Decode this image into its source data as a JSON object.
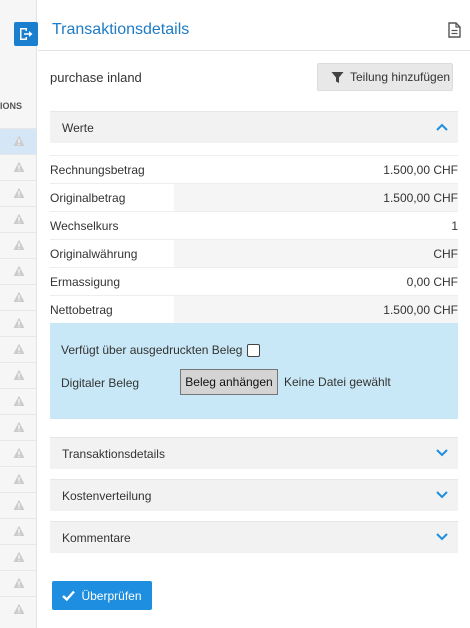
{
  "background_table": {
    "header_fragment": "IONS",
    "row_count": 19
  },
  "panel": {
    "title": "Transaktionsdetails",
    "name": "purchase inland",
    "split_button_label": "Teilung hinzufügen"
  },
  "werte": {
    "label": "Werte",
    "expanded": true,
    "rows": [
      {
        "label": "Rechnungsbetrag",
        "value": "1.500,00 CHF"
      },
      {
        "label": "Originalbetrag",
        "value": "1.500,00 CHF"
      },
      {
        "label": "Wechselkurs",
        "value": "1"
      },
      {
        "label": "Originalwährung",
        "value": "CHF"
      },
      {
        "label": "Ermassigung",
        "value": "0,00 CHF"
      },
      {
        "label": "Nettobetrag",
        "value": "1.500,00 CHF"
      }
    ]
  },
  "receipt": {
    "printed_label": "Verfügt über ausgedruckten Beleg",
    "printed_checked": false,
    "digital_label": "Digitaler Beleg",
    "attach_button_label": "Beleg anhängen",
    "no_file_text": "Keine Datei gewählt"
  },
  "sections": [
    {
      "label": "Transaktionsdetails",
      "expanded": false
    },
    {
      "label": "Kostenverteilung",
      "expanded": false
    },
    {
      "label": "Kommentare",
      "expanded": false
    }
  ],
  "footer": {
    "check_button_label": "Überprüfen"
  },
  "colors": {
    "accent": "#1e7bc5",
    "primary_button": "#1e8fe0",
    "receipt_background": "#c9e8f7",
    "warning_icon": "#cccccc"
  }
}
